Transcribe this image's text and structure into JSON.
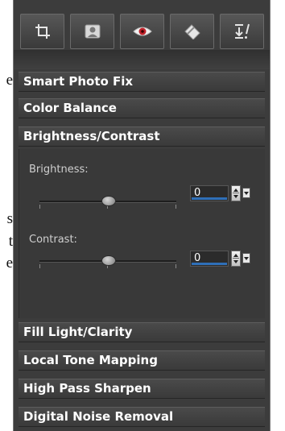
{
  "background_text": [
    "e",
    "s",
    "t",
    "e"
  ],
  "toolbar": {
    "buttons": [
      {
        "icon": "crop-icon"
      },
      {
        "icon": "portrait-icon"
      },
      {
        "icon": "red-eye-icon"
      },
      {
        "icon": "eraser-icon"
      },
      {
        "icon": "download-menu-icon"
      }
    ]
  },
  "sections": {
    "smart_photo_fix": "Smart Photo Fix",
    "color_balance": "Color Balance",
    "brightness_contrast": "Brightness/Contrast",
    "fill_light_clarity": "Fill Light/Clarity",
    "local_tone_mapping": "Local Tone Mapping",
    "high_pass_sharpen": "High Pass Sharpen",
    "digital_noise_removal": "Digital Noise Removal"
  },
  "brightness": {
    "label": "Brightness:",
    "value": "0",
    "slider_fraction": 0.5
  },
  "contrast": {
    "label": "Contrast:",
    "value": "0",
    "slider_fraction": 0.5
  },
  "colors": {
    "accent": "#2f6fb8",
    "panel": "#3c3c3c",
    "header_text": "#ffffff"
  }
}
